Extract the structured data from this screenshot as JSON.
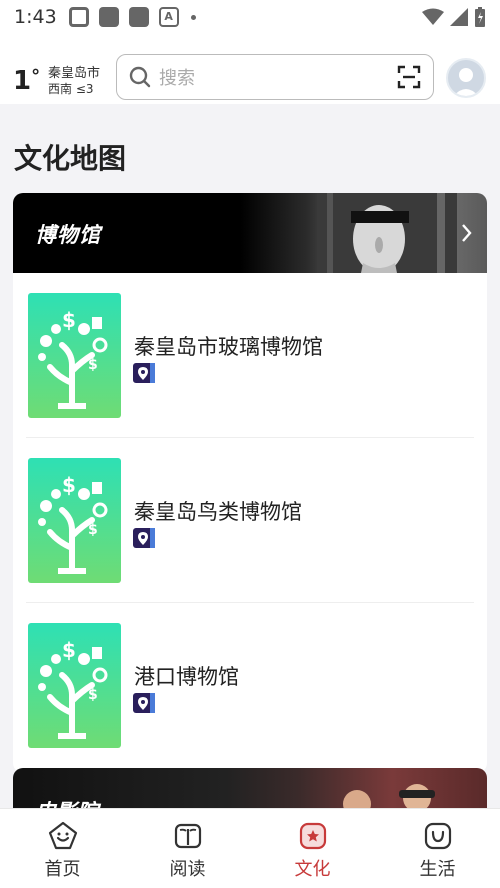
{
  "status_bar": {
    "time": "1:43"
  },
  "header": {
    "temperature": "1",
    "degree": "°",
    "city": "秦皇岛市",
    "wind": "西南 ≤3",
    "search_placeholder": "搜索"
  },
  "page": {
    "title": "文化地图"
  },
  "museum_section": {
    "title": "博物馆",
    "items": [
      {
        "name": "秦皇岛市玻璃博物馆"
      },
      {
        "name": "秦皇岛鸟类博物馆"
      },
      {
        "name": "港口博物馆"
      }
    ]
  },
  "cinema_section": {
    "title": "电影院"
  },
  "bottom_nav": {
    "items": [
      {
        "label": "首页"
      },
      {
        "label": "阅读"
      },
      {
        "label": "文化"
      },
      {
        "label": "生活"
      }
    ],
    "active_index": 2
  },
  "colors": {
    "accent": "#c73a3a",
    "thumb_top": "#2ee0b4",
    "thumb_bottom": "#6fdc74"
  }
}
